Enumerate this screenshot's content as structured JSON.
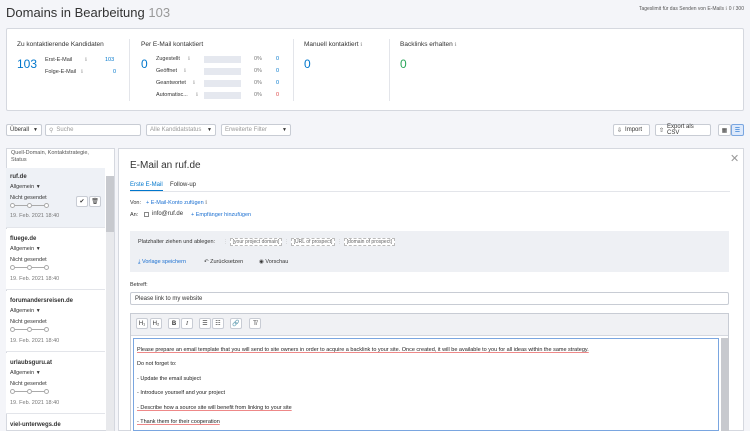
{
  "header": {
    "title": "Domains in Bearbeitung",
    "count": "103",
    "daily_limit_label": "Tageslimit für das Senden von E-Mails",
    "daily_limit_value": "0 / 300"
  },
  "stats": {
    "to_contact": {
      "title": "Zu kontaktierende Kandidaten",
      "total": "103",
      "first_label": "Erst-E-Mail",
      "first_value": "103",
      "followup_label": "Folge-E-Mail",
      "followup_value": "0"
    },
    "email_contacted": {
      "title": "Per E-Mail kontaktiert",
      "total": "0",
      "rows": [
        {
          "label": "Zugestellt",
          "percent": "0%",
          "value": "0"
        },
        {
          "label": "Geöffnet",
          "percent": "0%",
          "value": "0"
        },
        {
          "label": "Geantwortet",
          "percent": "0%",
          "value": "0"
        },
        {
          "label": "Automatisc...",
          "percent": "0%",
          "value": "0"
        }
      ]
    },
    "manual": {
      "title": "Manuell kontaktiert",
      "total": "0"
    },
    "backlinks": {
      "title": "Backlinks erhalten",
      "total": "0"
    }
  },
  "toolbar": {
    "scope_select": "Überall",
    "search_placeholder": "Suche",
    "status_filter": "Alle Kandidatstatus",
    "advanced_filter": "Erweiterte Filter",
    "import_label": "Import",
    "export_label": "Export als CSV"
  },
  "list": {
    "header": "Quell-Domain, Kontaktstrategie, Status",
    "items": [
      {
        "domain": "ruf.de",
        "strategy": "Allgemein",
        "status": "Nicht gesendet",
        "date": "19. Feb. 2021 18:40"
      },
      {
        "domain": "fluege.de",
        "strategy": "Allgemein",
        "status": "Nicht gesendet",
        "date": "19. Feb. 2021 18:40"
      },
      {
        "domain": "forumandersreisen.de",
        "strategy": "Allgemein",
        "status": "Nicht gesendet",
        "date": "19. Feb. 2021 18:40"
      },
      {
        "domain": "urlaubsguru.at",
        "strategy": "Allgemein",
        "status": "Nicht gesendet",
        "date": "19. Feb. 2021 18:40"
      },
      {
        "domain": "viel-unterwegs.de"
      }
    ]
  },
  "email": {
    "title": "E-Mail an ruf.de",
    "tab_first": "Erste E-Mail",
    "tab_followup": "Follow-up",
    "from_label": "Von:",
    "from_link": "E-Mail-Konto zufügen",
    "to_label": "An:",
    "to_value": "info@ruf.de",
    "add_recipient": "Empfänger hinzufügen",
    "placeholder_label": "Platzhalter ziehen und ablegen:",
    "placeholders": [
      "[your project domain]",
      "[URL of prospect]",
      "[domain of prospect]"
    ],
    "save_template": "Vorlage speichern",
    "reset": "Zurücksetzen",
    "preview": "Vorschau",
    "subject_label": "Betreff:",
    "subject_value": "Please link to my website",
    "body": {
      "line1": "Please prepare an email template that you will send to site owners in order to acquire a backlink to your site. Once created, it will be available to you for all ideas within the same strategy.",
      "line2": "Do not forget to:",
      "line3": "- Update the email subject",
      "line4": "- Introduce yourself and your project",
      "line5": "- Describe how a source site will benefit from linking to your site",
      "line6": "- Thank them for their cooperation"
    }
  },
  "colors": {
    "blue": "#0077cc",
    "green": "#2aa65a",
    "link_blue": "#1a6fd1"
  }
}
